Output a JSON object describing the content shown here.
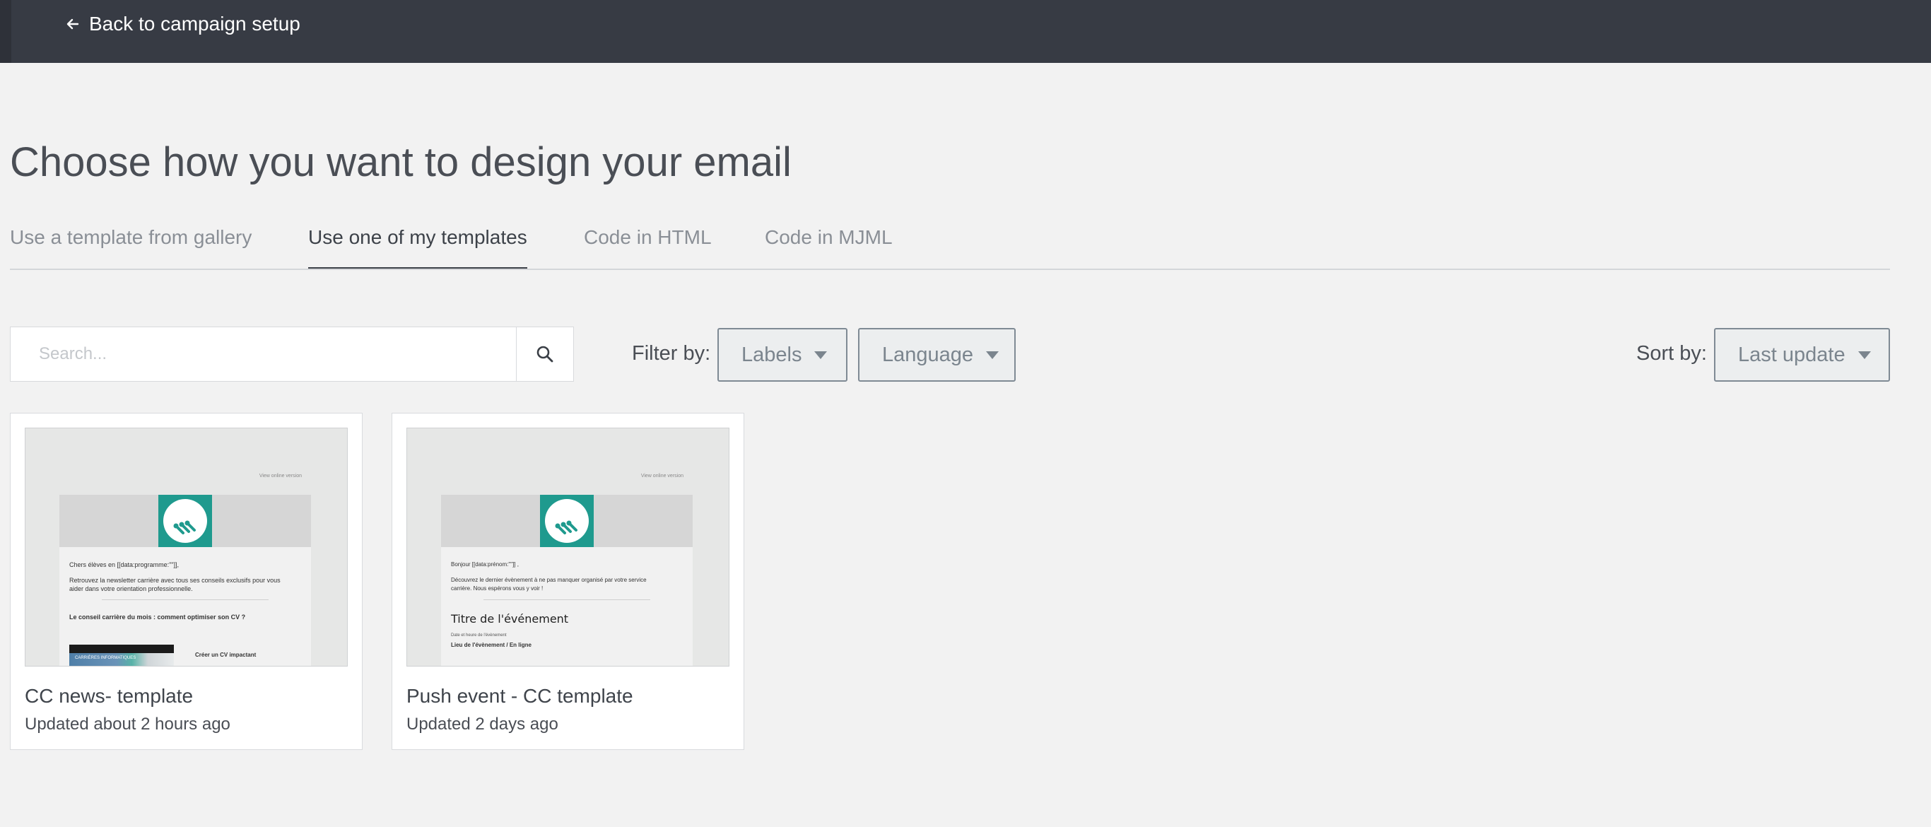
{
  "topbar": {
    "back_label": "Back to campaign setup",
    "back_icon": "arrow-left-icon"
  },
  "page": {
    "title": "Choose how you want to design your email"
  },
  "tabs": [
    {
      "label": "Use a template from gallery",
      "active": false
    },
    {
      "label": "Use one of my templates",
      "active": true
    },
    {
      "label": "Code in HTML",
      "active": false
    },
    {
      "label": "Code in MJML",
      "active": false
    }
  ],
  "search": {
    "placeholder": "Search...",
    "value": "",
    "icon": "search-icon"
  },
  "filters": {
    "label": "Filter by:",
    "labels_dropdown": "Labels",
    "language_dropdown": "Language"
  },
  "sort": {
    "label": "Sort by:",
    "value": "Last update"
  },
  "templates": [
    {
      "title": "CC news- template",
      "updated": "Updated about 2 hours ago",
      "preview": {
        "view_online": "View online version",
        "lines": [
          "Chers élèves en [[data:programme:\"\"]],",
          "Retrouvez la newsletter carrière avec tous ses conseils exclusifs pour vous",
          "aider dans votre orientation professionnelle.",
          "Le conseil carrière du mois : comment optimiser son CV ?",
          "CARRIÈRES INFORMATIQUES",
          "Créer un CV impactant"
        ]
      }
    },
    {
      "title": "Push event - CC template",
      "updated": "Updated 2 days ago",
      "preview": {
        "view_online": "View online version",
        "lines": [
          "Bonjour [[data:prénom:\"\"]] ,",
          "Découvrez le dernier évènement à ne pas manquer organisé par votre service",
          "carrière. Nous espérons vous y voir !",
          "Titre de l'événement",
          "Date et heure de l'évènement",
          "Lieu de l'évènement / En ligne"
        ]
      }
    }
  ],
  "colors": {
    "topbar": "#373b44",
    "background": "#f2f2f2",
    "brand_teal": "#1f9a8e"
  }
}
